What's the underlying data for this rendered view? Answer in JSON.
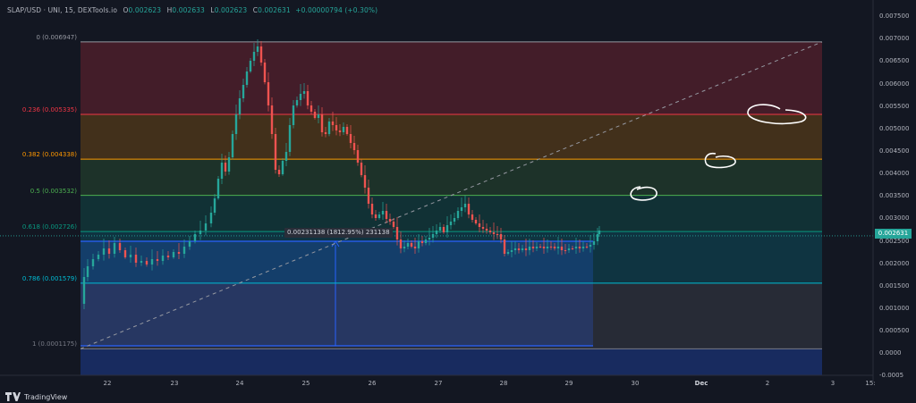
{
  "header": {
    "symbol": "SLAP/USD · UNI, 15, DEXTools.io",
    "open_label": "O",
    "open": "0.002623",
    "high_label": "H",
    "high": "0.002633",
    "low_label": "L",
    "low": "0.002623",
    "close_label": "C",
    "close": "0.002631",
    "change": "+0.00000794 (+0.30%)"
  },
  "fib_levels": [
    {
      "label": "0 (0.006947)",
      "ratio": 0,
      "price": 0.006947,
      "color": "#9598a1"
    },
    {
      "label": "0.236 (0.005335)",
      "ratio": 0.236,
      "price": 0.005335,
      "color": "#f23645"
    },
    {
      "label": "0.382 (0.004338)",
      "ratio": 0.382,
      "price": 0.004338,
      "color": "#ff9800"
    },
    {
      "label": "0.5 (0.003532)",
      "ratio": 0.5,
      "price": 0.003532,
      "color": "#4caf50"
    },
    {
      "label": "0.618 (0.002726)",
      "ratio": 0.618,
      "price": 0.002726,
      "color": "#089981"
    },
    {
      "label": "0.786 (0.001579)",
      "ratio": 0.786,
      "price": 0.001579,
      "color": "#00bcd4"
    },
    {
      "label": "1 (0.0001175)",
      "ratio": 1,
      "price": 0.0001175,
      "color": "#787b86"
    }
  ],
  "y_axis": [
    "0.007500",
    "0.007000",
    "0.006500",
    "0.006000",
    "0.005500",
    "0.005000",
    "0.004500",
    "0.004000",
    "0.003500",
    "0.003000",
    "0.002500",
    "0.002000",
    "0.001500",
    "0.001000",
    "0.000500",
    "0.0000",
    "-0.0005"
  ],
  "y_axis_values": [
    0.0075,
    0.007,
    0.0065,
    0.006,
    0.0055,
    0.005,
    0.0045,
    0.004,
    0.0035,
    0.003,
    0.0025,
    0.002,
    0.0015,
    0.001,
    0.0005,
    0.0,
    -0.0005
  ],
  "x_axis": [
    "22",
    "23",
    "24",
    "25",
    "26",
    "27",
    "28",
    "29",
    "30",
    "Dec",
    "2",
    "3",
    "15:"
  ],
  "price_tag": "0.002631",
  "measure_label": "0.00231138 (1812.95%) 231138",
  "branding": "TradingView",
  "colors": {
    "background": "#131722",
    "up": "#26a69a",
    "down": "#ef5350",
    "measure": "#2962ff"
  }
}
